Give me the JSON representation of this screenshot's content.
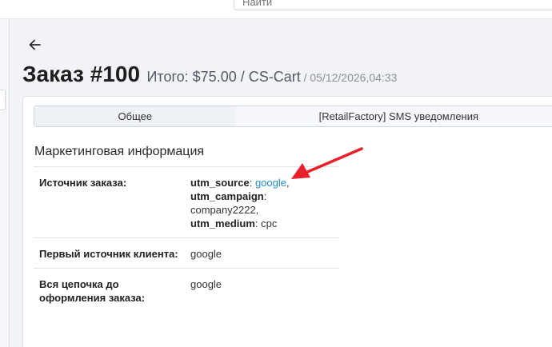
{
  "header": {
    "search_placeholder": "Найти"
  },
  "order": {
    "title": "Заказ #100",
    "total": "Итого: $75.00 / CS-Cart",
    "date": " / 05/12/2026,04:33"
  },
  "tabs": [
    {
      "label": "Общее"
    },
    {
      "label": "[RetailFactory] SMS уведомления"
    }
  ],
  "section": {
    "title": "Маркетинговая информация"
  },
  "rows": {
    "source": {
      "label": "Источник заказа:",
      "utm_source_key": "utm_source",
      "utm_source_value": "google",
      "utm_campaign_key": "utm_campaign",
      "utm_campaign_value": "company2222,",
      "utm_medium_key": "utm_medium",
      "utm_medium_value": "cpc"
    },
    "first_source": {
      "label": "Первый источник клиента:",
      "value": "google"
    },
    "chain": {
      "label": "Вся цепочка до оформления заказа:",
      "value": "google"
    }
  },
  "colors": {
    "accent_link": "#1f8bd3",
    "annotation_arrow": "#e8202a"
  },
  "icons": {
    "back": "arrow-left-icon"
  }
}
